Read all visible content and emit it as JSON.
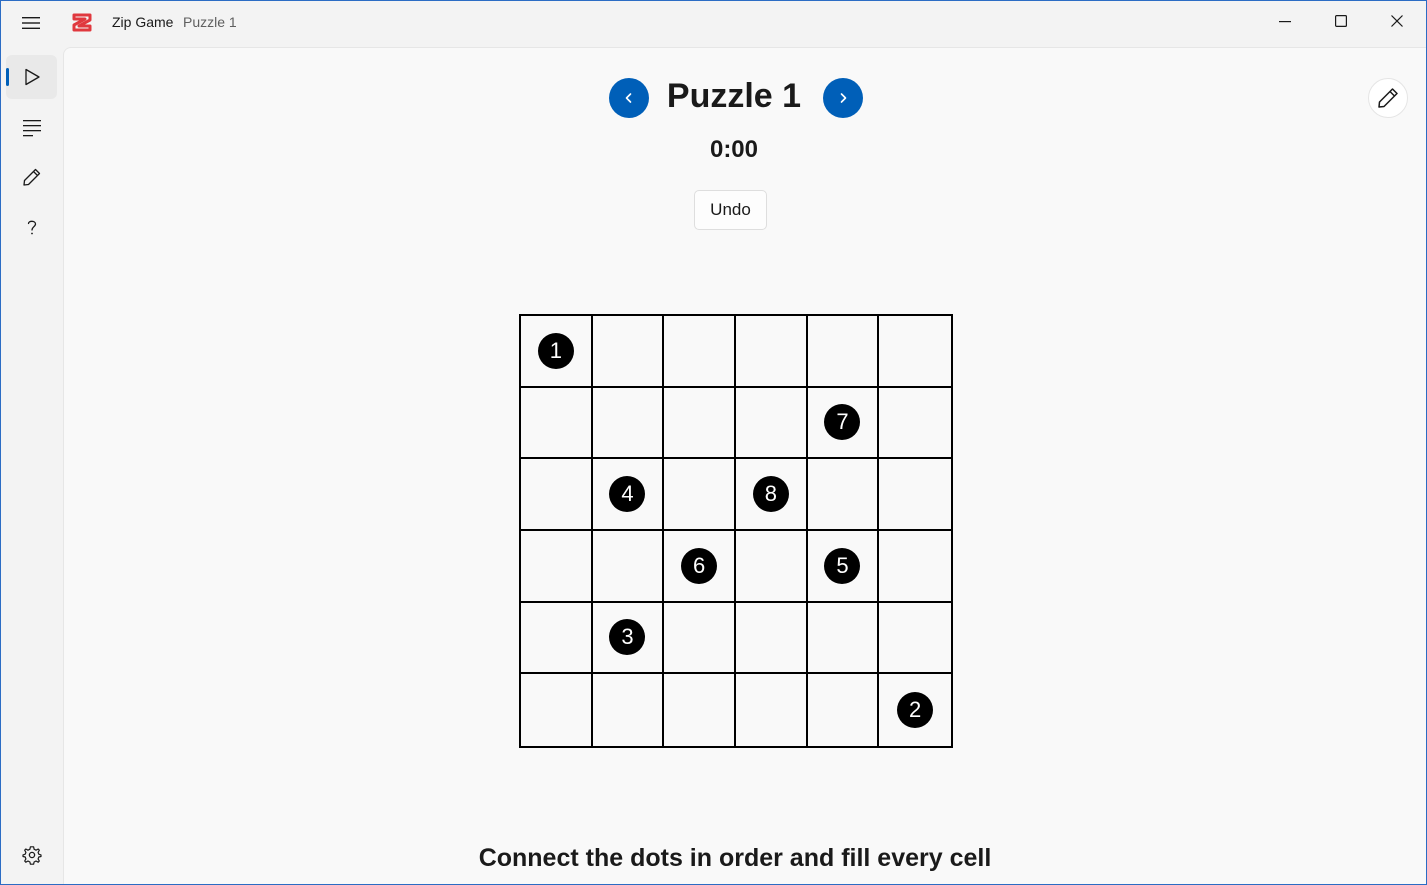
{
  "app": {
    "title": "Zip Game",
    "subtitle": "Puzzle 1"
  },
  "nav": {
    "items": [
      {
        "name": "play",
        "icon": "play-icon",
        "active": true
      },
      {
        "name": "list",
        "icon": "list-icon",
        "active": false
      },
      {
        "name": "edit",
        "icon": "pencil-icon",
        "active": false
      },
      {
        "name": "help",
        "icon": "help-icon",
        "active": false
      }
    ],
    "settings_icon": "gear-icon"
  },
  "main": {
    "puzzle_title": "Puzzle 1",
    "timer": "0:00",
    "undo_label": "Undo",
    "instructions": "Connect the dots in order and fill every cell"
  },
  "grid": {
    "rows": 6,
    "cols": 6,
    "dots": [
      {
        "row": 0,
        "col": 0,
        "label": "1"
      },
      {
        "row": 1,
        "col": 4,
        "label": "7"
      },
      {
        "row": 2,
        "col": 1,
        "label": "4"
      },
      {
        "row": 2,
        "col": 3,
        "label": "8"
      },
      {
        "row": 3,
        "col": 2,
        "label": "6"
      },
      {
        "row": 3,
        "col": 4,
        "label": "5"
      },
      {
        "row": 4,
        "col": 1,
        "label": "3"
      },
      {
        "row": 5,
        "col": 5,
        "label": "2"
      }
    ]
  },
  "colors": {
    "accent": "#005fb8",
    "logo": "#e0383e",
    "dot": "#000000"
  }
}
